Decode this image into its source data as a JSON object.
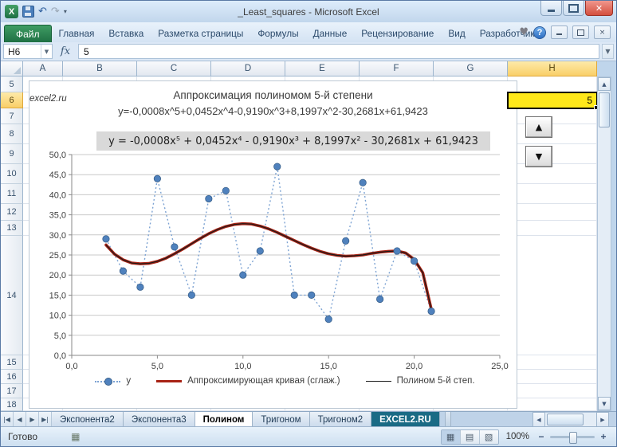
{
  "window": {
    "title": "_Least_squares  -  Microsoft Excel",
    "quick_access_icons": [
      "excel-logo",
      "save",
      "undo",
      "redo",
      "customize-quick-access"
    ],
    "control_icons": [
      "minimize",
      "maximize",
      "close"
    ]
  },
  "ribbon": {
    "file_tab": "Файл",
    "tabs": [
      "Главная",
      "Вставка",
      "Разметка страницы",
      "Формулы",
      "Данные",
      "Рецензирование",
      "Вид",
      "Разработчик"
    ],
    "right_icons": [
      "heart",
      "help",
      "minimize-window",
      "restore-window",
      "close-window"
    ]
  },
  "formula_bar": {
    "name_box": "H6",
    "fx_label": "fx",
    "value": "5"
  },
  "grid": {
    "columns": [
      "A",
      "B",
      "C",
      "D",
      "E",
      "F",
      "G",
      "H"
    ],
    "rows": [
      "5",
      "6",
      "7",
      "8",
      "9",
      "10",
      "11",
      "12",
      "13",
      "14",
      "15",
      "16",
      "17",
      "18"
    ],
    "selected_column": "H",
    "selected_row": "6",
    "selected_cell": "H6",
    "selected_cell_fill": "#ffe81a",
    "cells": {
      "A6": "excel2.ru",
      "H6": "5"
    }
  },
  "chart_data": {
    "type": "scatter",
    "title": "Аппроксимация полиномом 5-й степени",
    "subtitle": "y=-0,0008x^5+0,0452x^4-0,9190x^3+8,1997x^2-30,2681x+61,9423",
    "equation_label": "y = -0,0008x⁵ + 0,0452x⁴ - 0,9190x³ + 8,1997x² - 30,2681x + 61,9423",
    "equation_box_fill": "#d9d9d9",
    "xlim": [
      0,
      25
    ],
    "ylim": [
      0,
      50
    ],
    "x_tick_values": [
      0,
      5,
      10,
      15,
      20,
      25
    ],
    "x_tick_labels": [
      "0,0",
      "5,0",
      "10,0",
      "15,0",
      "20,0",
      "25,0"
    ],
    "y_tick_values": [
      0,
      5,
      10,
      15,
      20,
      25,
      30,
      35,
      40,
      45,
      50
    ],
    "y_tick_labels": [
      "0,0",
      "5,0",
      "10,0",
      "15,0",
      "20,0",
      "25,0",
      "30,0",
      "35,0",
      "40,0",
      "45,0",
      "50,0"
    ],
    "grid": "horizontal",
    "legend_position": "bottom",
    "series": [
      {
        "name": "y",
        "kind": "scatter",
        "line_style": "dotted",
        "color": "#4f81bd",
        "line_color": "#7da3d3",
        "x": [
          2,
          3,
          4,
          5,
          6,
          7,
          8,
          9,
          10,
          11,
          12,
          13,
          14,
          15,
          16,
          17,
          18,
          19,
          20,
          21
        ],
        "y": [
          29,
          21,
          17,
          44,
          27,
          15,
          39,
          41,
          20,
          26,
          47,
          15,
          15,
          9,
          28.5,
          43,
          14,
          26,
          23.5,
          11
        ]
      },
      {
        "name": "Аппроксимирующая кривая (сглаж.)",
        "kind": "line",
        "color": "#a82315",
        "width": 3.6,
        "x": [
          2,
          2.5,
          3,
          3.5,
          4,
          4.5,
          5,
          5.5,
          6,
          6.5,
          7,
          7.5,
          8,
          8.5,
          9,
          9.5,
          10,
          10.5,
          11,
          11.5,
          12,
          12.5,
          13,
          13.5,
          14,
          14.5,
          15,
          15.5,
          16,
          16.5,
          17,
          17.5,
          18,
          18.5,
          19,
          19.5,
          20,
          20.5,
          21
        ],
        "y": [
          27.5,
          25.2,
          23.8,
          23,
          22.8,
          22.9,
          23.4,
          24.2,
          25.3,
          26.5,
          27.8,
          29.1,
          30.3,
          31.3,
          32.1,
          32.6,
          32.8,
          32.7,
          32.2,
          31.5,
          30.6,
          29.6,
          28.6,
          27.6,
          26.7,
          25.9,
          25.3,
          24.9,
          24.7,
          24.8,
          25,
          25.4,
          25.7,
          25.9,
          26,
          25.5,
          23.9,
          20.6,
          11.5
        ]
      },
      {
        "name": "Полином 5-й степ.",
        "kind": "line",
        "color": "#1a1a1a",
        "width": 1.2,
        "x": [
          2,
          2.5,
          3,
          3.5,
          4,
          4.5,
          5,
          5.5,
          6,
          6.5,
          7,
          7.5,
          8,
          8.5,
          9,
          9.5,
          10,
          10.5,
          11,
          11.5,
          12,
          12.5,
          13,
          13.5,
          14,
          14.5,
          15,
          15.5,
          16,
          16.5,
          17,
          17.5,
          18,
          18.5,
          19,
          19.5,
          20,
          20.5,
          21
        ],
        "y": [
          27.5,
          25.2,
          23.8,
          23,
          22.8,
          22.9,
          23.4,
          24.2,
          25.3,
          26.5,
          27.8,
          29.1,
          30.3,
          31.3,
          32.1,
          32.6,
          32.8,
          32.7,
          32.2,
          31.5,
          30.6,
          29.6,
          28.6,
          27.6,
          26.7,
          25.9,
          25.3,
          24.9,
          24.7,
          24.8,
          25,
          25.4,
          25.7,
          25.9,
          26,
          25.5,
          23.9,
          20.6,
          11.5
        ]
      }
    ]
  },
  "sheet_tabs": {
    "tabs": [
      {
        "label": "Экспонента2"
      },
      {
        "label": "Экспонента3"
      },
      {
        "label": "Полином",
        "active": true
      },
      {
        "label": "Тригоном"
      },
      {
        "label": "Тригоном2"
      },
      {
        "label": "EXCEL2.RU",
        "fill": "#1a6b85",
        "text_color": "#ffffff"
      }
    ]
  },
  "status_bar": {
    "mode": "Готово",
    "zoom": "100%",
    "view_button_icons": [
      "normal-view",
      "page-layout-view",
      "page-break-view"
    ]
  }
}
